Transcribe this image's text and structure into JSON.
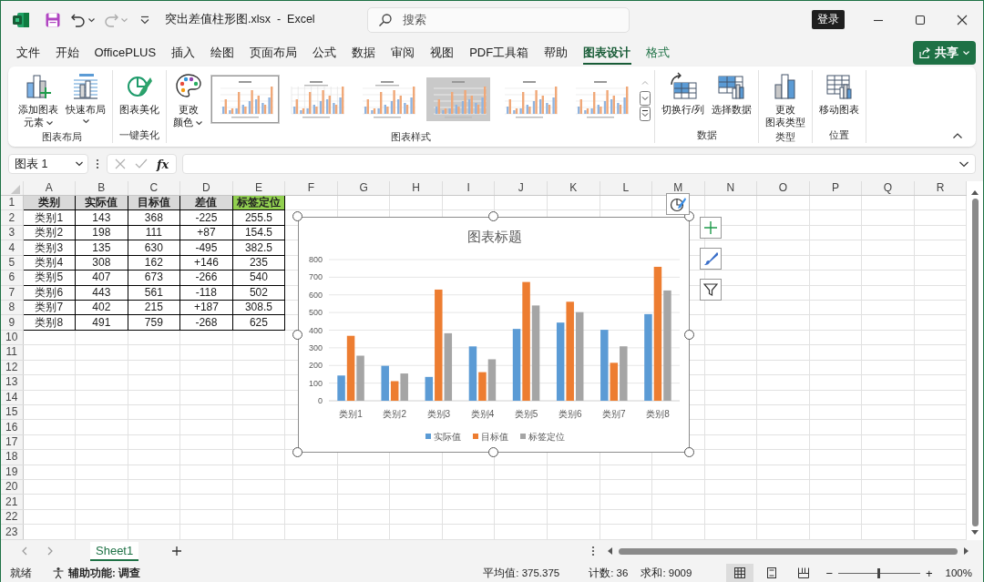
{
  "title_bar": {
    "document_title": "突出差值柱形图.xlsx  -  Excel",
    "search": {
      "placeholder": "搜索"
    },
    "sign_in_button": "登录"
  },
  "menu_tabs": [
    {
      "label": "文件",
      "selected": false,
      "contextual": false
    },
    {
      "label": "开始",
      "selected": false,
      "contextual": false
    },
    {
      "label": "OfficePLUS",
      "selected": false,
      "contextual": false
    },
    {
      "label": "插入",
      "selected": false,
      "contextual": false
    },
    {
      "label": "绘图",
      "selected": false,
      "contextual": false
    },
    {
      "label": "页面布局",
      "selected": false,
      "contextual": false
    },
    {
      "label": "公式",
      "selected": false,
      "contextual": false
    },
    {
      "label": "数据",
      "selected": false,
      "contextual": false
    },
    {
      "label": "审阅",
      "selected": false,
      "contextual": false
    },
    {
      "label": "视图",
      "selected": false,
      "contextual": false
    },
    {
      "label": "PDF工具箱",
      "selected": false,
      "contextual": false
    },
    {
      "label": "帮助",
      "selected": false,
      "contextual": false
    },
    {
      "label": "图表设计",
      "selected": true,
      "contextual": true
    },
    {
      "label": "格式",
      "selected": false,
      "contextual": true
    }
  ],
  "share_button": "共享",
  "ribbon": {
    "groups": [
      {
        "label": "图表布局",
        "items": [
          {
            "kind": "button",
            "lines": [
              "添加图表",
              "元素"
            ],
            "dropdown": true
          },
          {
            "kind": "button",
            "lines": [
              "快速布局"
            ],
            "dropdown": true
          }
        ]
      },
      {
        "label": "一键美化",
        "items": [
          {
            "kind": "button",
            "lines": [
              "图表美化"
            ],
            "dropdown": false
          }
        ]
      },
      {
        "label": "图表样式",
        "items": [
          {
            "kind": "button",
            "lines": [
              "更改",
              "颜色"
            ],
            "dropdown": true
          },
          {
            "kind": "gallery",
            "thumbnails": [
              {
                "selected": true
              },
              {
                "selected": false
              },
              {
                "selected": false
              },
              {
                "selected": false
              },
              {
                "selected": false
              },
              {
                "selected": false
              }
            ]
          }
        ]
      },
      {
        "label": "数据",
        "items": [
          {
            "kind": "button",
            "lines": [
              "切换行/列"
            ],
            "dropdown": false
          },
          {
            "kind": "button",
            "lines": [
              "选择数据"
            ],
            "dropdown": false
          }
        ]
      },
      {
        "label": "类型",
        "items": [
          {
            "kind": "button",
            "lines": [
              "更改",
              "图表类型"
            ],
            "dropdown": false
          }
        ]
      },
      {
        "label": "位置",
        "items": [
          {
            "kind": "button",
            "lines": [
              "移动图表"
            ],
            "dropdown": false
          }
        ]
      }
    ]
  },
  "formula_bar": {
    "name_box": "图表 1",
    "function_button": "fx"
  },
  "sheet": {
    "column_letters": [
      "A",
      "B",
      "C",
      "D",
      "E",
      "F",
      "G",
      "H",
      "I",
      "J",
      "K",
      "L",
      "M",
      "N",
      "O",
      "P",
      "Q",
      "R"
    ],
    "row_numbers": [
      "1",
      "2",
      "3",
      "4",
      "5",
      "6",
      "7",
      "8",
      "9",
      "10",
      "11",
      "12",
      "13",
      "14",
      "15",
      "16",
      "17",
      "18",
      "19",
      "20",
      "21",
      "22",
      "23"
    ],
    "header": [
      {
        "text": "类别",
        "color": "#d9d9d9"
      },
      {
        "text": "实际值",
        "color": "#d9d9d9"
      },
      {
        "text": "目标值",
        "color": "#d9d9d9"
      },
      {
        "text": "差值",
        "color": "#d9d9d9"
      },
      {
        "text": "标签定位",
        "color": "#92d050"
      }
    ],
    "rows": [
      [
        "类别1",
        "143",
        "368",
        "-225",
        "255.5"
      ],
      [
        "类别2",
        "198",
        "111",
        "+87",
        "154.5"
      ],
      [
        "类别3",
        "135",
        "630",
        "-495",
        "382.5"
      ],
      [
        "类别4",
        "308",
        "162",
        "+146",
        "235"
      ],
      [
        "类别5",
        "407",
        "673",
        "-266",
        "540"
      ],
      [
        "类别6",
        "443",
        "561",
        "-118",
        "502"
      ],
      [
        "类别7",
        "402",
        "215",
        "+187",
        "308.5"
      ],
      [
        "类别8",
        "491",
        "759",
        "-268",
        "625"
      ]
    ]
  },
  "chart": {
    "chart_data": {
      "type": "bar",
      "title": "图表标题",
      "categories": [
        "类别1",
        "类别2",
        "类别3",
        "类别4",
        "类别5",
        "类别6",
        "类别7",
        "类别8"
      ],
      "series": [
        {
          "name": "实际值",
          "color": "#5b9bd5",
          "values": [
            143,
            198,
            135,
            308,
            407,
            443,
            402,
            491
          ]
        },
        {
          "name": "目标值",
          "color": "#ed7d31",
          "values": [
            368,
            111,
            630,
            162,
            673,
            561,
            215,
            759
          ]
        },
        {
          "name": "标签定位",
          "color": "#a5a5a5",
          "values": [
            255.5,
            154.5,
            382.5,
            235,
            540,
            502,
            308.5,
            625
          ]
        }
      ],
      "ylim": [
        0,
        800
      ],
      "yticks": [
        0,
        100,
        200,
        300,
        400,
        500,
        600,
        700,
        800
      ],
      "grid": true,
      "legend": true
    }
  },
  "sheet_tabs": [
    {
      "label": "Sheet1",
      "selected": true
    }
  ],
  "status_bar": {
    "ready": "就绪",
    "accessibility": "辅助功能: 调查",
    "average": "平均值: 375.375",
    "count": "计数: 36",
    "sum": "求和: 9009",
    "views": [
      {
        "selected": true
      },
      {
        "selected": false
      },
      {
        "selected": false
      }
    ],
    "zoom_out": "−",
    "zoom": {
      "level": 0.5
    },
    "zoom_in": "+",
    "zoom_percent": "100%"
  }
}
